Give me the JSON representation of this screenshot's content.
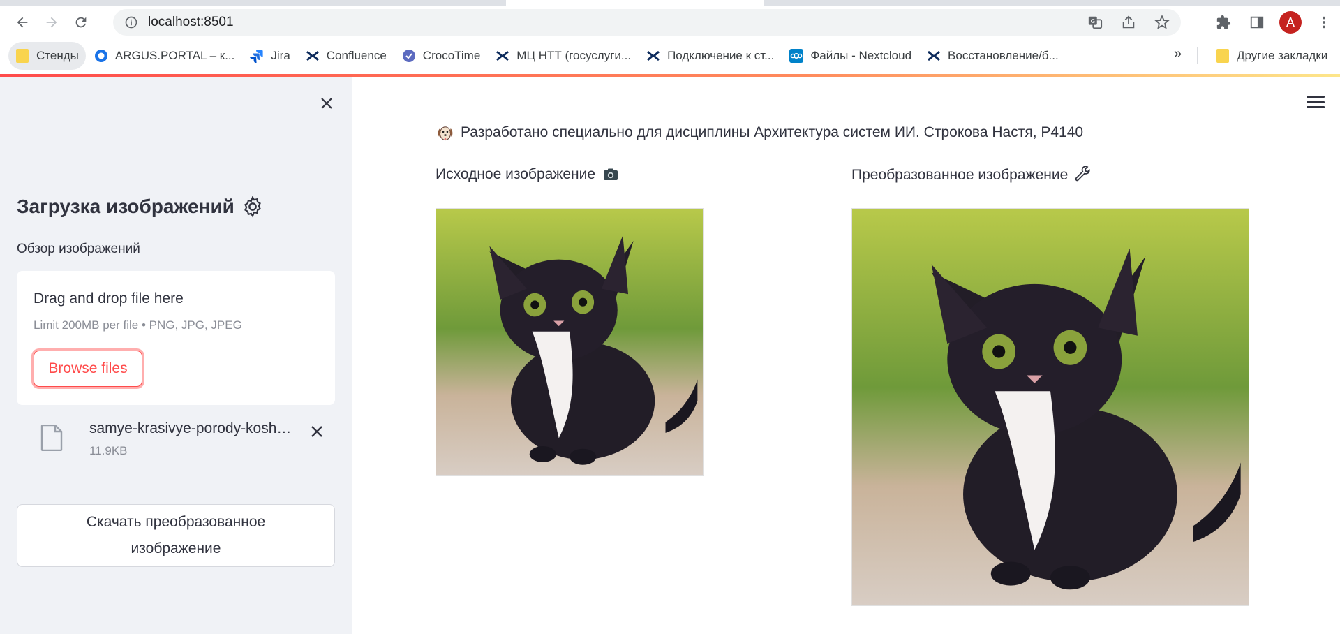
{
  "browser": {
    "url": "localhost:8501",
    "profile_initial": "A",
    "bookmarks": [
      {
        "label": "Стенды",
        "icon": "folder-icon"
      },
      {
        "label": "ARGUS.PORTAL – к...",
        "icon": "argus-icon"
      },
      {
        "label": "Jira",
        "icon": "jira-icon"
      },
      {
        "label": "Confluence",
        "icon": "confluence-icon"
      },
      {
        "label": "CrocoTime",
        "icon": "crocotime-icon"
      },
      {
        "label": "МЦ НТТ (госуслуги...",
        "icon": "confluence-icon"
      },
      {
        "label": "Подключение к ст...",
        "icon": "confluence-icon"
      },
      {
        "label": "Файлы - Nextcloud",
        "icon": "nextcloud-icon"
      },
      {
        "label": "Восстановление/б...",
        "icon": "confluence-icon"
      }
    ],
    "more_label": "»",
    "other_bookmarks": "Другие закладки"
  },
  "sidebar": {
    "title": "Загрузка изображений",
    "title_icon": "gear-icon",
    "uploader_label": "Обзор изображений",
    "dropzone": {
      "main": "Drag and drop file here",
      "limits": "Limit 200MB per file • PNG, JPG, JPEG",
      "browse_label": "Browse files"
    },
    "file": {
      "name": "samye-krasivye-porody-koshek.jpg",
      "size": "11.9KB"
    },
    "download_label": "Скачать преобразованное изображение"
  },
  "main": {
    "caption_icon": "dog-icon",
    "caption": "Разработано специально для дисциплины Архитектура систем ИИ. Строкова Настя, P4140",
    "original_title": "Исходное изображение",
    "original_icon": "camera-icon",
    "transformed_title": "Преобразованное изображение",
    "transformed_icon": "wrench-icon"
  },
  "colors": {
    "accent": "#ff4b4b",
    "sidebar_bg": "#f0f2f6",
    "text": "#31333f"
  }
}
